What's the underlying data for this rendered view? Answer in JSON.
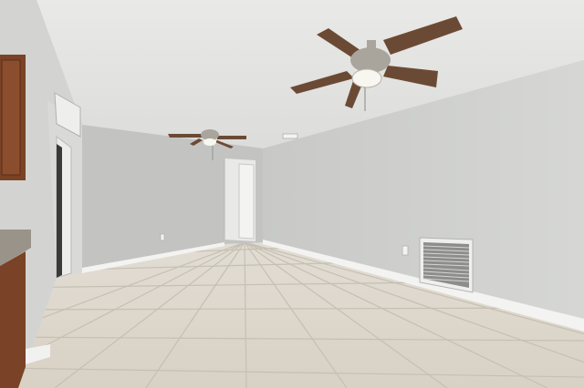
{
  "scene": {
    "description_visible_text": "",
    "colors": {
      "ceiling": "#e4e4e2",
      "wall_right": "#cfd0ce",
      "wall_back": "#c4c5c3",
      "wall_left": "#d2d3d1",
      "floor_tile": "#ddd7cc",
      "grout": "#c9c2b5",
      "baseboard": "#f4f4f2",
      "fan_blade": "#6b4a35",
      "fan_metal": "#a9a59d",
      "cabinet": "#7a4226",
      "countertop": "#9a938a",
      "vent": "#e8e8e6"
    }
  }
}
